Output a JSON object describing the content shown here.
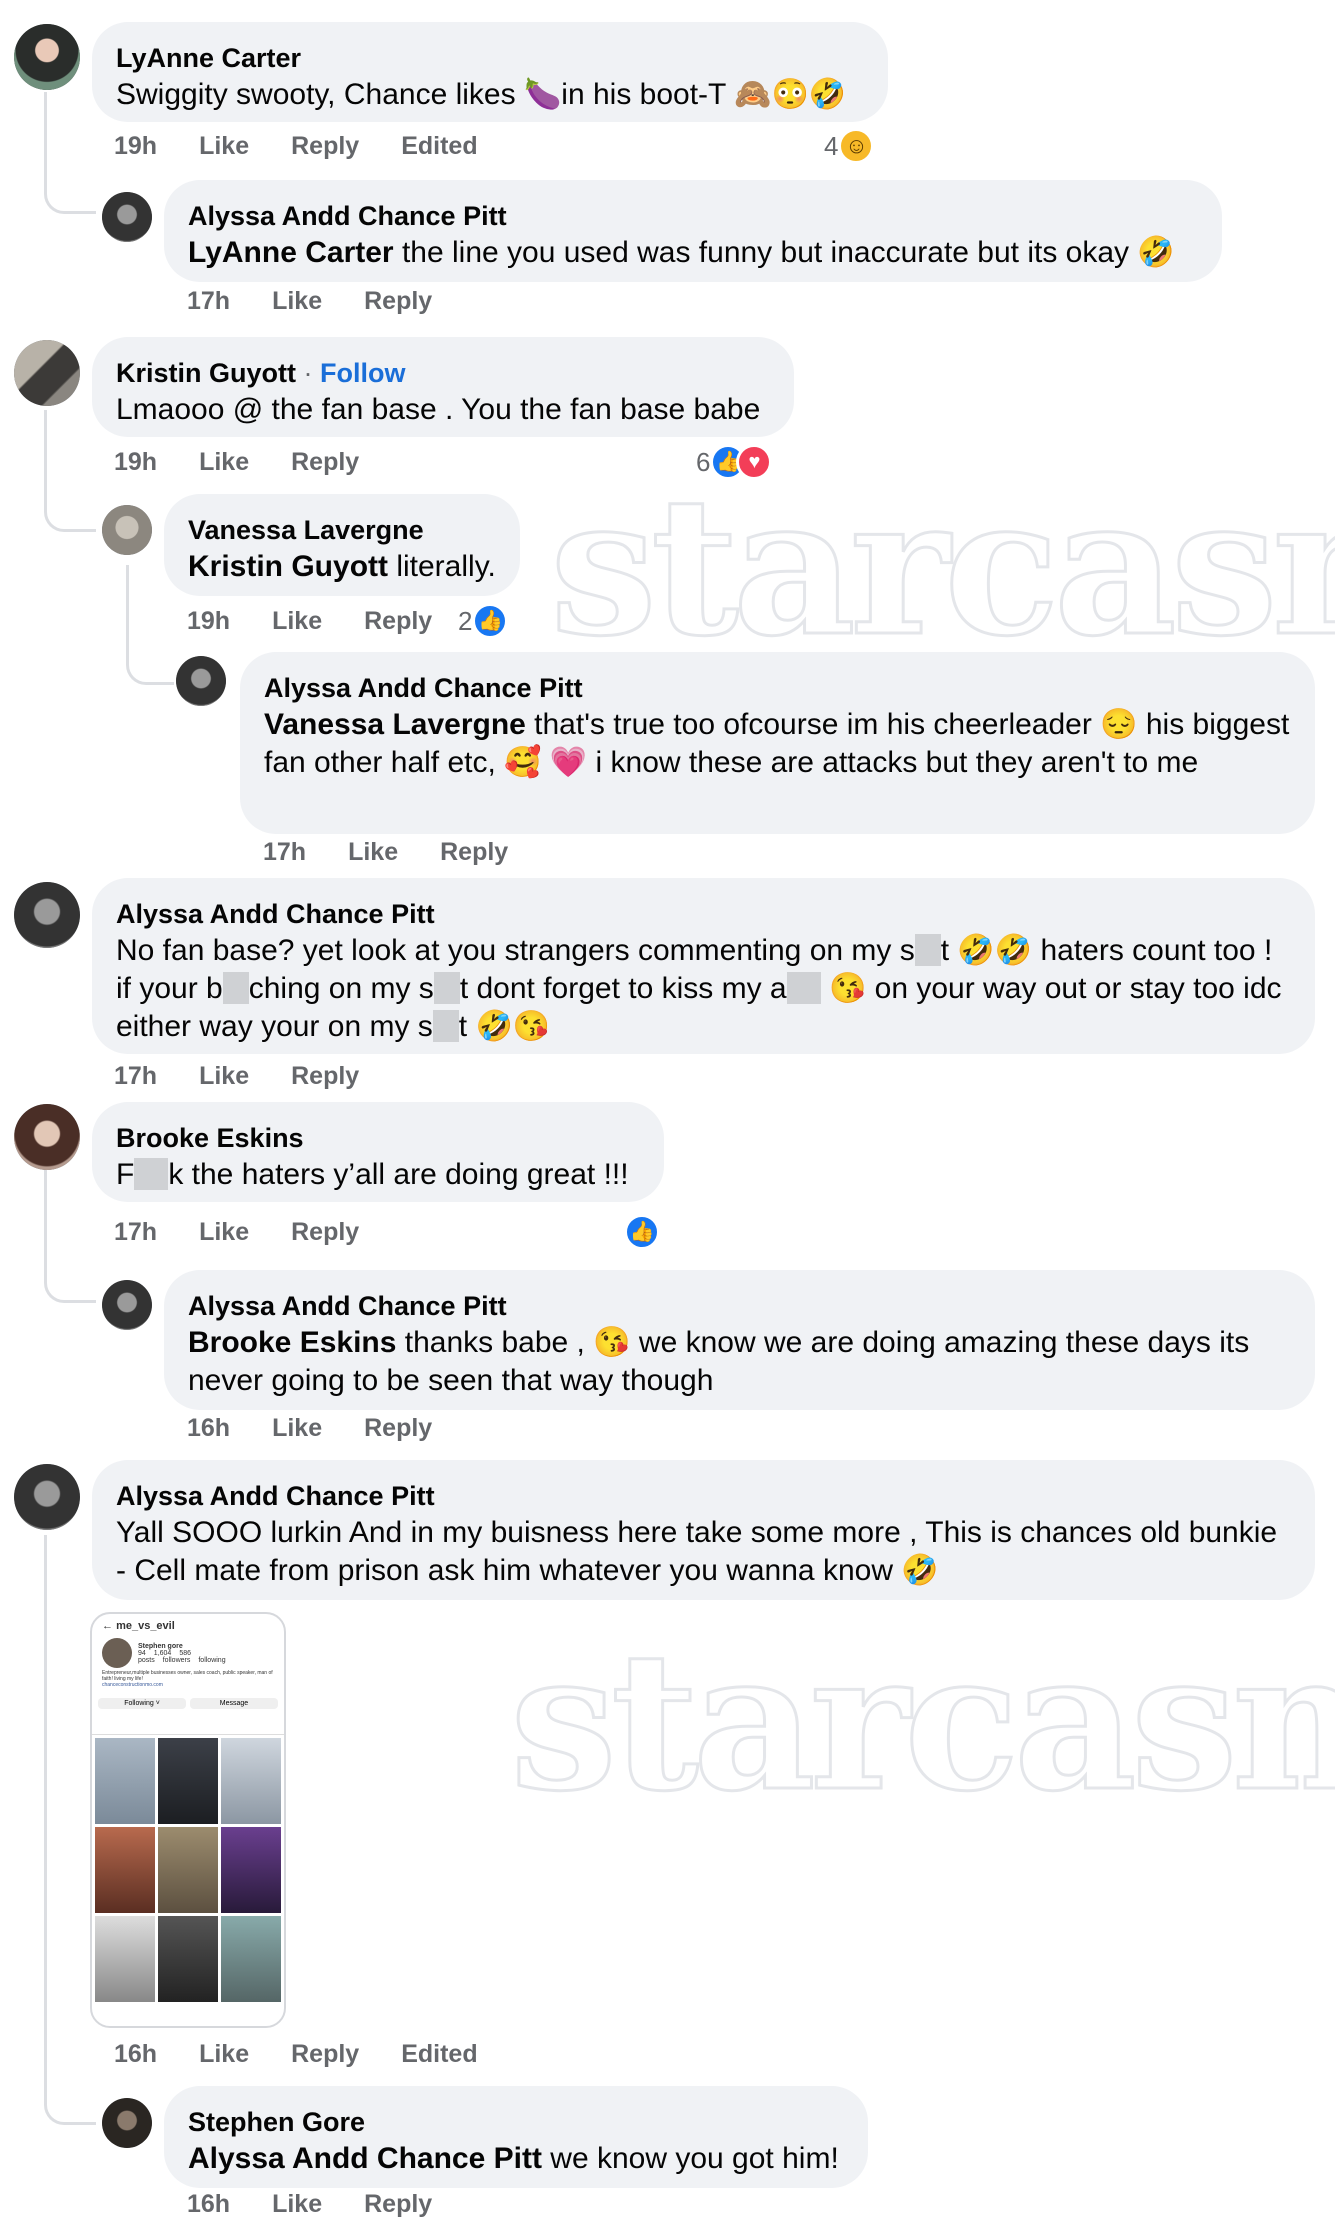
{
  "comments": [
    {
      "author": "LyAnne Carter",
      "text": "Swiggity swooty, Chance likes 🍆in his boot-T 🙈😳🤣",
      "time": "19h",
      "like": "Like",
      "reply": "Reply",
      "edited": "Edited",
      "reaction_count": "4"
    },
    {
      "author": "Alyssa Andd Chance Pitt",
      "mention": "LyAnne Carter",
      "text": " the line you used was funny but inaccurate but its okay 🤣",
      "time": "17h",
      "like": "Like",
      "reply": "Reply"
    },
    {
      "author": "Kristin Guyott",
      "follow": "Follow",
      "text": "Lmaooo @ the fan base . You the fan base babe",
      "time": "19h",
      "like": "Like",
      "reply": "Reply",
      "reaction_count": "6"
    },
    {
      "author": "Vanessa Lavergne",
      "mention": "Kristin Guyott",
      "text": " literally.",
      "time": "19h",
      "like": "Like",
      "reply": "Reply",
      "reaction_count": "2"
    },
    {
      "author": "Alyssa Andd Chance Pitt",
      "mention": "Vanessa Lavergne",
      "text": " that's true too ofcourse im his cheerleader 😔 his biggest fan other half etc, 🥰 💗 i know these are attacks but they aren't to me",
      "time": "17h",
      "like": "Like",
      "reply": "Reply"
    },
    {
      "author": "Alyssa Andd Chance Pitt",
      "text_parts": [
        "No fan base? yet look at you strangers commenting on my s",
        "t 🤣🤣 haters count too ! if your b",
        "ching on my s",
        "t dont forget to kiss my a",
        " 😘 on your way out or stay too idc either way your on my s",
        "t 🤣😘"
      ],
      "time": "17h",
      "like": "Like",
      "reply": "Reply"
    },
    {
      "author": "Brooke Eskins",
      "text_parts": [
        "F",
        "k the haters y’all are doing great !!!"
      ],
      "time": "17h",
      "like": "Like",
      "reply": "Reply"
    },
    {
      "author": "Alyssa Andd Chance Pitt",
      "mention": "Brooke Eskins",
      "text": " thanks babe , 😘 we know we are doing amazing these days its never going to be seen that way though",
      "time": "16h",
      "like": "Like",
      "reply": "Reply"
    },
    {
      "author": "Alyssa Andd Chance Pitt",
      "text": "Yall SOOO lurkin And in my buisness here take some more , This is chances old bunkie - Cell mate from prison ask him whatever you wanna know 🤣",
      "time": "16h",
      "like": "Like",
      "reply": "Reply",
      "edited": "Edited"
    },
    {
      "author": "Stephen Gore",
      "mention": "Alyssa Andd Chance Pitt",
      "text": " we know you got him!",
      "time": "16h",
      "like": "Like",
      "reply": "Reply"
    }
  ],
  "attachment": {
    "username": "me_vs_evil",
    "profile_name": "Stephen gore",
    "posts": "94",
    "posts_label": "posts",
    "followers": "1,604",
    "followers_label": "followers",
    "following": "586",
    "following_label": "following",
    "bio": "Entrepreneur,multiple businesses owner, sales coach, public speaker, man of faith! living my life!",
    "link": "chanceconstructionmo.com",
    "following_btn": "Following ˅",
    "message_btn": "Message"
  },
  "watermark": "starcasm",
  "colors": {
    "bubble": "#f0f2f5",
    "like_blue": "#1877f2",
    "love_red": "#f33e58",
    "meta_gray": "#65676b"
  }
}
